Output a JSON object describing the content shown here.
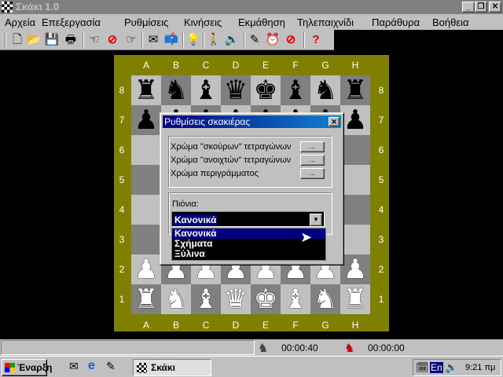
{
  "window": {
    "title": "Σκάκι 1.0",
    "minimize": "_",
    "restore": "❐",
    "close": "✕"
  },
  "menu": [
    "Αρχεία",
    "Επεξεργασία",
    "Ρυθμίσεις",
    "Κινήσεις",
    "Εκμάθηση",
    "Τηλεπαιχνίδι",
    "Παράθυρα",
    "Βοήθεια"
  ],
  "toolbar": [
    {
      "name": "new-icon",
      "glyph": "🗋"
    },
    {
      "name": "open-icon",
      "glyph": "📂"
    },
    {
      "name": "save-icon",
      "glyph": "💾"
    },
    {
      "name": "print-icon",
      "glyph": "🖶"
    },
    {
      "name": "take-back-icon",
      "glyph": "☜"
    },
    {
      "name": "stop-icon",
      "glyph": "⊘"
    },
    {
      "name": "forward-icon",
      "glyph": "☞"
    },
    {
      "name": "message-icon",
      "glyph": "✉"
    },
    {
      "name": "mailbox-icon",
      "glyph": "📫"
    },
    {
      "name": "hint-bulb-icon",
      "glyph": "💡"
    },
    {
      "name": "move-icon",
      "glyph": "🚶"
    },
    {
      "name": "sound-icon",
      "glyph": "🔊"
    },
    {
      "name": "edit-icon",
      "glyph": "✎"
    },
    {
      "name": "clock-icon",
      "glyph": "⏰"
    },
    {
      "name": "no-clock-icon",
      "glyph": "⊘"
    },
    {
      "name": "help-icon",
      "glyph": "?"
    }
  ],
  "colors": {
    "frame": "#808000",
    "light": "#c0c0c0",
    "dark": "#808080",
    "accent": "#000080"
  },
  "board": {
    "files": [
      "A",
      "B",
      "C",
      "D",
      "E",
      "F",
      "G",
      "H"
    ],
    "ranks": [
      "8",
      "7",
      "6",
      "5",
      "4",
      "3",
      "2",
      "1"
    ],
    "rows": [
      "rnbqkbnr",
      "pppppppp",
      "........",
      "........",
      "........",
      "........",
      "PPPPPPPP",
      "RNBQKBNR"
    ]
  },
  "dialog": {
    "title": "Ρυθμίσεις σκακιέρας",
    "dark_label": "Χρώμα \"σκούρων\" τετραγώνων",
    "light_label": "Χρώμα \"ανοιχτών\" τετραγώνων",
    "border_label": "Χρώμα περιγράμματος",
    "dots": "...",
    "pawns_label": "Πιόνια:",
    "pawns_value": "Κανονικά",
    "options": [
      "Κανονικά",
      "Σχήματα",
      "Ξύλινα"
    ]
  },
  "status": {
    "white_clock": "00:00:40",
    "black_clock": "00:00:00"
  },
  "taskbar": {
    "start": "Έναρξη",
    "task": "Σκάκι",
    "lang": "En",
    "time": "9:21 πμ"
  }
}
